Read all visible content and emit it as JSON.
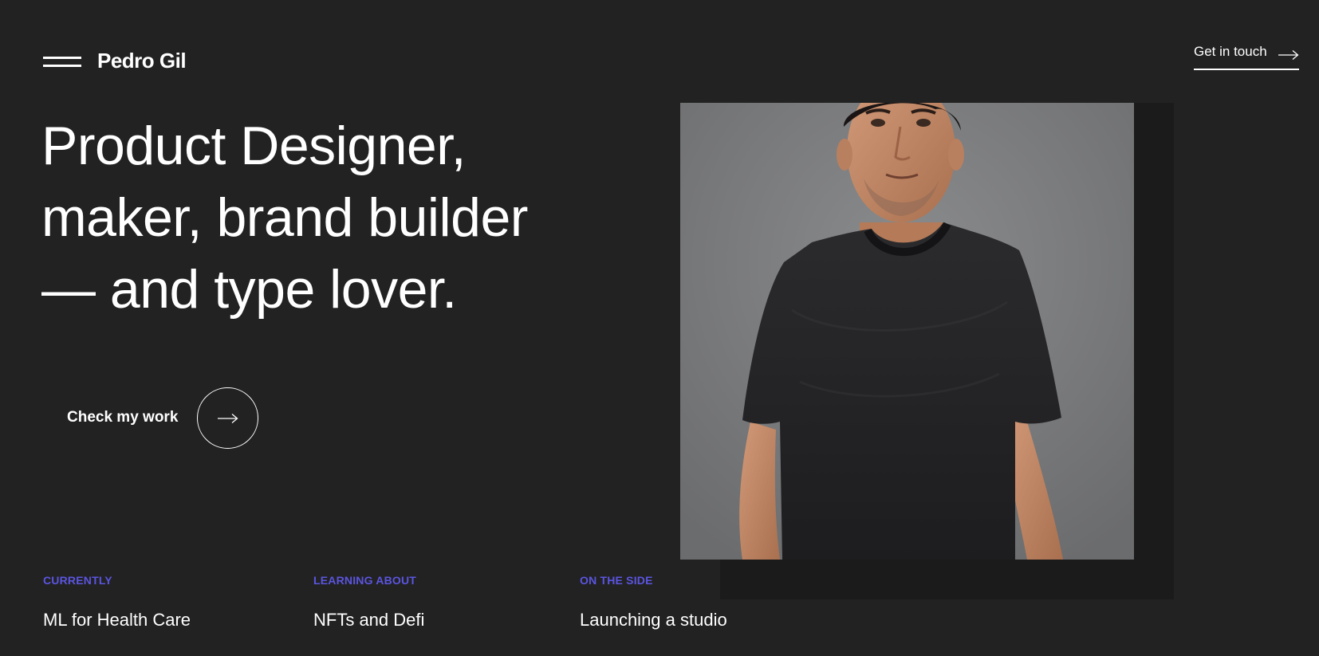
{
  "header": {
    "brand": "Pedro Gil",
    "menu_icon": "hamburger-menu-icon",
    "contact_label": "Get in touch",
    "contact_icon": "arrow-right-icon"
  },
  "hero": {
    "headline_lines": [
      "Product Designer,",
      "maker, brand builder",
      "— and type lover."
    ],
    "cta_label": "Check my work",
    "cta_icon": "arrow-right-icon",
    "portrait_alt_icon": "portrait-photo"
  },
  "info": [
    {
      "label": "CURRENTLY",
      "value": "ML for Health Care"
    },
    {
      "label": "LEARNING ABOUT",
      "value": "NFTs and Defi"
    },
    {
      "label": "ON THE SIDE",
      "value": "Launching a studio"
    }
  ],
  "colors": {
    "background": "#222222",
    "accent": "#5b55e0",
    "text": "#ffffff"
  }
}
